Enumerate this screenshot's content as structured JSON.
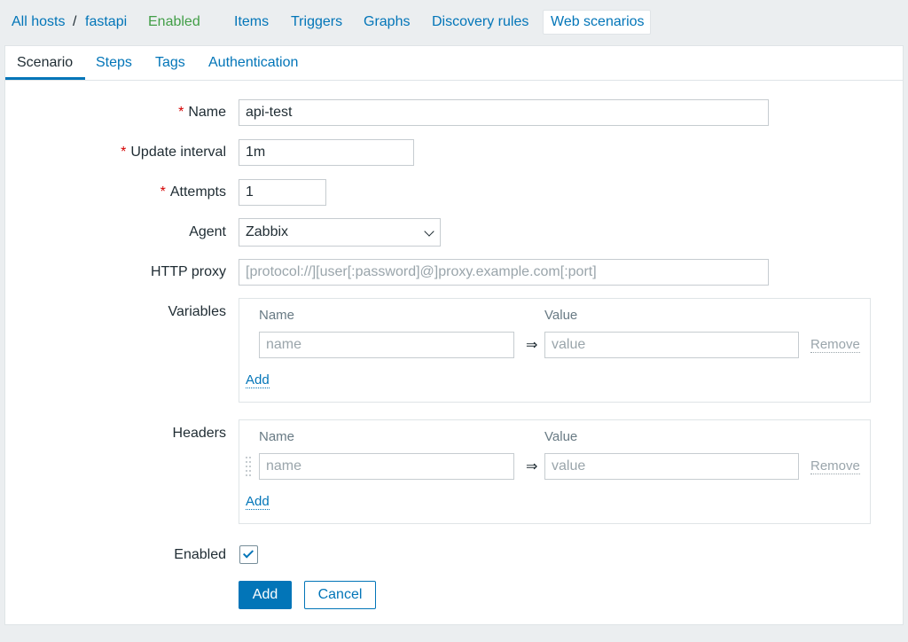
{
  "breadcrumb": {
    "all_hosts": "All hosts",
    "separator": "/",
    "host": "fastapi",
    "status": "Enabled"
  },
  "host_nav": {
    "items": "Items",
    "triggers": "Triggers",
    "graphs": "Graphs",
    "discovery_rules": "Discovery rules",
    "web_scenarios": "Web scenarios"
  },
  "form_tabs": {
    "scenario": "Scenario",
    "steps": "Steps",
    "tags": "Tags",
    "authentication": "Authentication"
  },
  "form": {
    "required_mark": "*",
    "name": {
      "label": "Name",
      "value": "api-test"
    },
    "update_interval": {
      "label": "Update interval",
      "value": "1m"
    },
    "attempts": {
      "label": "Attempts",
      "value": "1"
    },
    "agent": {
      "label": "Agent",
      "value": "Zabbix"
    },
    "http_proxy": {
      "label": "HTTP proxy",
      "placeholder": "[protocol://][user[:password]@]proxy.example.com[:port]"
    },
    "variables": {
      "label": "Variables",
      "col_name": "Name",
      "col_value": "Value",
      "name_placeholder": "name",
      "value_placeholder": "value",
      "arrow": "⇒",
      "remove": "Remove",
      "add": "Add"
    },
    "headers": {
      "label": "Headers",
      "col_name": "Name",
      "col_value": "Value",
      "name_placeholder": "name",
      "value_placeholder": "value",
      "arrow": "⇒",
      "remove": "Remove",
      "add": "Add"
    },
    "enabled": {
      "label": "Enabled",
      "checked": true
    }
  },
  "buttons": {
    "add": "Add",
    "cancel": "Cancel"
  },
  "colors": {
    "link": "#0275b8",
    "status_enabled": "#429e47",
    "required": "#d40000",
    "primary_button": "#0275b8"
  }
}
